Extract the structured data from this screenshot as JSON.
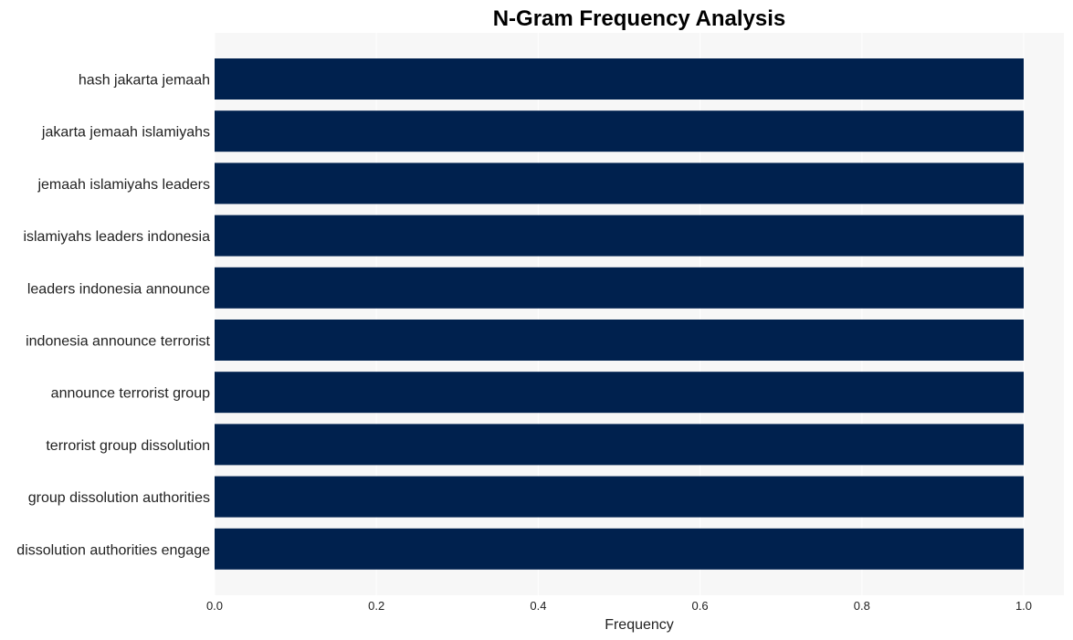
{
  "chart_data": {
    "type": "bar",
    "orientation": "horizontal",
    "title": "N-Gram Frequency Analysis",
    "xlabel": "Frequency",
    "ylabel": "",
    "categories": [
      "hash jakarta jemaah",
      "jakarta jemaah islamiyahs",
      "jemaah islamiyahs leaders",
      "islamiyahs leaders indonesia",
      "leaders indonesia announce",
      "indonesia announce terrorist",
      "announce terrorist group",
      "terrorist group dissolution",
      "group dissolution authorities",
      "dissolution authorities engage"
    ],
    "values": [
      1,
      1,
      1,
      1,
      1,
      1,
      1,
      1,
      1,
      1
    ],
    "xlim": [
      0,
      1.05
    ],
    "xticks": [
      "0.0",
      "0.2",
      "0.4",
      "0.6",
      "0.8",
      "1.0"
    ],
    "xtick_values": [
      0,
      0.2,
      0.4,
      0.6,
      0.8,
      1.0
    ],
    "grid": true,
    "legend": "none",
    "colors": {
      "bar": "#00214e",
      "plot_background": "#f7f7f7",
      "grid": "#ffffff"
    }
  }
}
